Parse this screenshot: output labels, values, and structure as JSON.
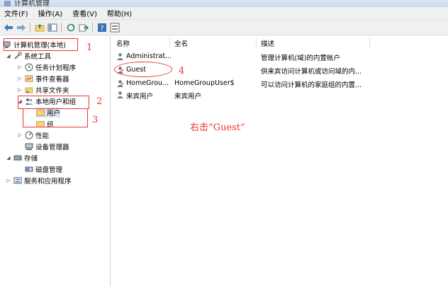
{
  "window": {
    "title": "计算机管理"
  },
  "menu": [
    "文件(F)",
    "操作(A)",
    "查看(V)",
    "帮助(H)"
  ],
  "toolbar": {
    "icons": [
      "back-arrow-icon",
      "forward-arrow-icon",
      "up-folder-icon",
      "show-hide-tree-icon",
      "refresh-icon",
      "export-icon",
      "help-icon",
      "properties-icon"
    ]
  },
  "tree": {
    "root": "计算机管理(本地)",
    "system_tools": "系统工具",
    "task_scheduler": "任务计划程序",
    "event_viewer": "事件查看器",
    "shared_folders": "共享文件夹",
    "local_users_groups": "本地用户和组",
    "users": "用户",
    "groups": "组",
    "performance": "性能",
    "device_manager": "设备管理器",
    "storage": "存储",
    "disk_management": "磁盘管理",
    "services_apps": "服务和应用程序"
  },
  "list": {
    "headers": {
      "name": "名称",
      "fullname": "全名",
      "description": "描述"
    },
    "rows": [
      {
        "name": "Administrat...",
        "fullname": "",
        "description": "管理计算机(域)的内置帐户"
      },
      {
        "name": "Guest",
        "fullname": "",
        "description": "供来宾访问计算机或访问域的内..."
      },
      {
        "name": "HomeGrou...",
        "fullname": "HomeGroupUser$",
        "description": "可以访问计算机的家庭组的内置..."
      },
      {
        "name": "来宾用户",
        "fullname": "来宾用户",
        "description": ""
      }
    ]
  },
  "annotations": {
    "n1": "1",
    "n2": "2",
    "n3": "3",
    "n4": "4",
    "instruction": "右击“Guest”",
    "color": "#e33333"
  }
}
